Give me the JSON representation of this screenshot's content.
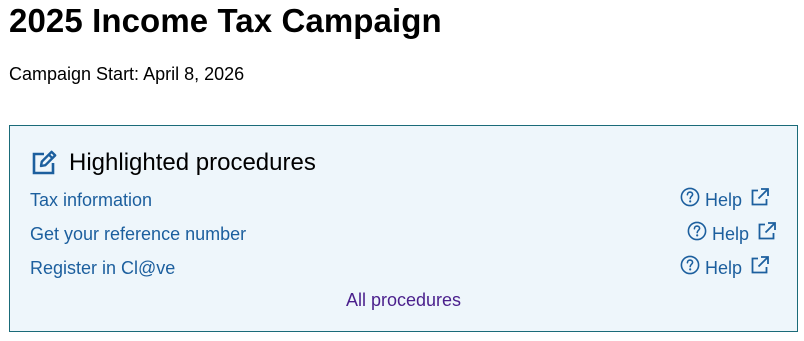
{
  "page": {
    "title": "2025 Income Tax Campaign",
    "campaign_start": "Campaign Start: April 8, 2026"
  },
  "panel": {
    "title": "Highlighted procedures",
    "icon": "edit-icon",
    "procedures": [
      {
        "label": "Tax information",
        "help_label": "Help"
      },
      {
        "label": "Get your reference number",
        "help_label": "Help"
      },
      {
        "label": "Register in Cl@ve",
        "help_label": "Help"
      }
    ],
    "all_procedures_label": "All procedures"
  },
  "colors": {
    "link": "#1c5f9e",
    "visited_link": "#4a1f8c",
    "panel_border": "#1a6b79",
    "panel_background": "#eef6fb"
  }
}
